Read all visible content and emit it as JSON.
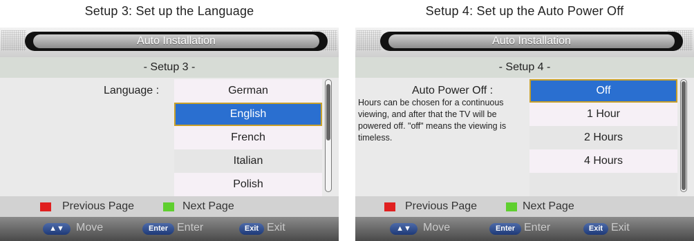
{
  "captions": {
    "left": "Setup 3: Set up the Language",
    "right": "Setup 4: Set up the Auto Power Off"
  },
  "left": {
    "title": "Auto Installation",
    "step": "- Setup 3 -",
    "field_label": "Language :",
    "options": [
      "German",
      "English",
      "French",
      "Italian",
      "Polish"
    ],
    "selected_index": 1,
    "scroll_position": 0.1
  },
  "right": {
    "title": "Auto Installation",
    "step": "- Setup 4 -",
    "field_label": "Auto Power Off :",
    "description": "Hours can be chosen for a continuous viewing, and after that the TV will be powered off. \"off\" means the viewing is timeless.",
    "options": [
      "Off",
      "1 Hour",
      "2 Hours",
      "4 Hours",
      ""
    ],
    "selected_index": 0
  },
  "footer": {
    "prev_label": "Previous Page",
    "next_label": "Next Page",
    "move_key": "▲▼",
    "move_label": "Move",
    "enter_key": "Enter",
    "enter_label": "Enter",
    "exit_key": "Exit",
    "exit_label": "Exit"
  },
  "colors": {
    "selected": "#2a6fd0",
    "selected_border": "#c8a02a",
    "red_key": "#e02020",
    "green_key": "#5fcf2f"
  }
}
